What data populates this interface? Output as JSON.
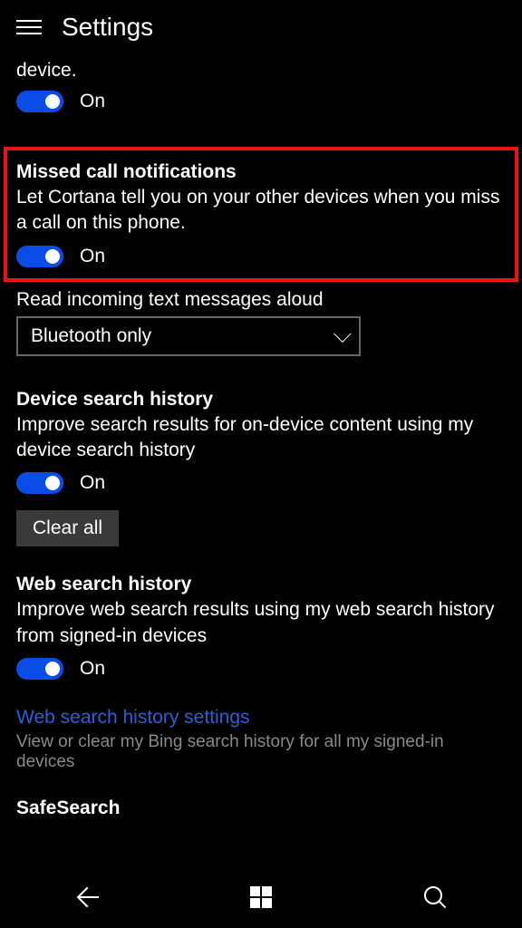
{
  "header": {
    "title": "Settings"
  },
  "partial_top": {
    "desc_end": "device.",
    "toggle_label": "On"
  },
  "missed_calls": {
    "title": "Missed call notifications",
    "desc": "Let Cortana tell you on your other devices when you miss a call on this phone.",
    "toggle_label": "On"
  },
  "read_aloud": {
    "label": "Read incoming text messages aloud",
    "selected": "Bluetooth only"
  },
  "device_history": {
    "title": "Device search history",
    "desc": "Improve search results for on-device content using my device search history",
    "toggle_label": "On",
    "clear_button": "Clear all"
  },
  "web_history": {
    "title": "Web search history",
    "desc": "Improve web search results using my web search history from signed-in devices",
    "toggle_label": "On"
  },
  "web_settings_link": {
    "title": "Web search history settings",
    "desc": "View or clear my Bing search history for all my signed-in devices"
  },
  "safesearch": {
    "title": "SafeSearch"
  }
}
